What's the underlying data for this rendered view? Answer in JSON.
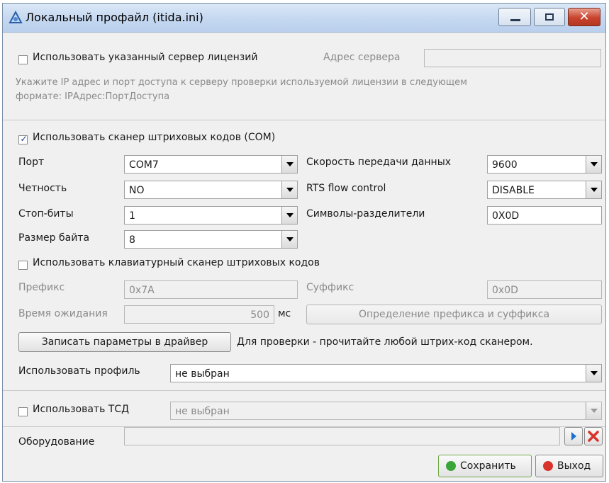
{
  "window": {
    "title": "Локальный профайл (itida.ini)",
    "close_glyph": "✕"
  },
  "license": {
    "use_label": "Использовать указанный сервер лицензий",
    "checked": false,
    "server_label": "Адрес сервера",
    "server_value": "",
    "hint_line1": "Укажите IP адрес и порт доступа к серверу проверки используемой лицензии в следующем",
    "hint_line2": "формате: IPАдрес:ПортДоступа"
  },
  "scanner": {
    "use_label": "Использовать сканер штриховых кодов (COM)",
    "checked": true,
    "check_glyph": "✓",
    "port_label": "Порт",
    "port_value": "COM7",
    "speed_label": "Скорость передачи данных",
    "speed_value": "9600",
    "parity_label": "Четность",
    "parity_value": "NO",
    "rts_label": "RTS flow control",
    "rts_value": "DISABLE",
    "stopbits_label": "Стоп-биты",
    "stopbits_value": "1",
    "separators_label": "Символы-разделители",
    "separators_value": "0X0D",
    "bytesize_label": "Размер байта",
    "bytesize_value": "8"
  },
  "kbd_scanner": {
    "use_label": "Использовать клавиатурный сканер штриховых кодов",
    "checked": false,
    "prefix_label": "Префикс",
    "prefix_value": "0x7A",
    "suffix_label": "Суффикс",
    "suffix_value": "0x0D",
    "timeout_label": "Время ожидания",
    "timeout_value": "500",
    "timeout_unit": "мс",
    "detect_button": "Определение префикса и суффикса"
  },
  "driver": {
    "write_button": "Записать параметры в драйвер",
    "hint": "Для проверки - прочитайте любой штрих-код сканером."
  },
  "profile": {
    "label": "Использовать профиль",
    "value": "не выбран"
  },
  "tsd": {
    "use_label": "Использовать ТСД",
    "checked": false,
    "value": "не выбран"
  },
  "equipment": {
    "label": "Оборудование",
    "value": ""
  },
  "footer": {
    "save_button": "Сохранить",
    "exit_button": "Выход"
  },
  "colors": {
    "save_icon": "#3aa63a",
    "exit_icon": "#d9342b",
    "play_icon": "#1e6fd0",
    "delete_icon": "#d9342b"
  }
}
